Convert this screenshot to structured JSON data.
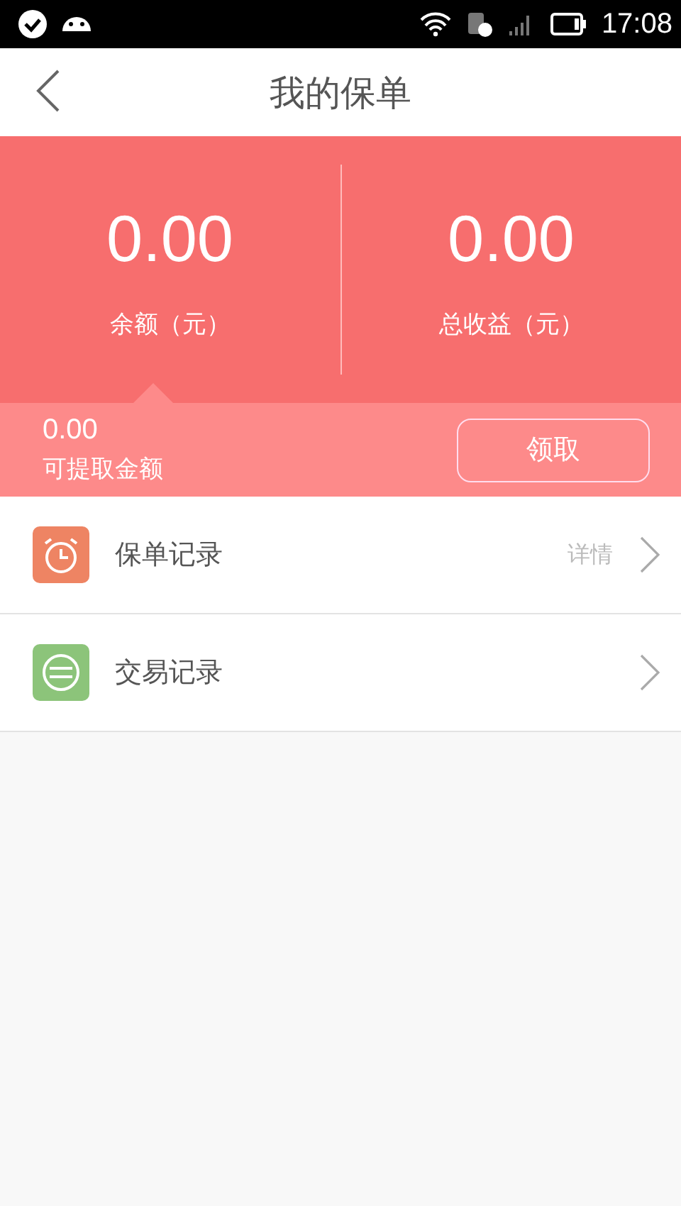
{
  "status_bar": {
    "time": "17:08"
  },
  "header": {
    "title": "我的保单"
  },
  "summary": {
    "stats": [
      {
        "value": "0.00",
        "label": "余额（元）"
      },
      {
        "value": "0.00",
        "label": "总收益（元）"
      }
    ],
    "withdrawable": {
      "value": "0.00",
      "label": "可提取金额"
    },
    "button": "领取"
  },
  "menu": [
    {
      "kind": "alarm",
      "color": "#ee8463",
      "label": "保单记录",
      "detail": "详情"
    },
    {
      "kind": "exchange",
      "color": "#8cc47a",
      "label": "交易记录"
    }
  ]
}
